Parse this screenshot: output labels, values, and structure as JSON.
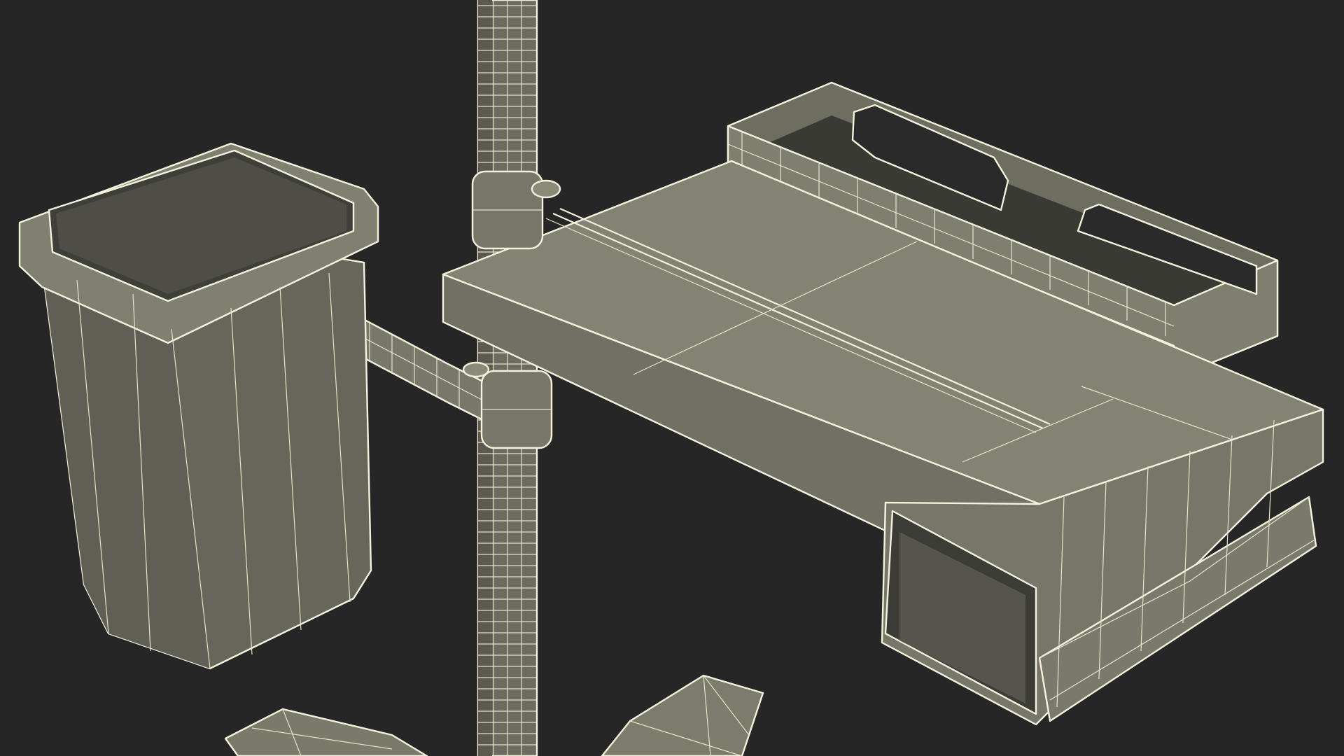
{
  "scene": {
    "colors": {
      "background": "#262626",
      "surface_light": "#80806f",
      "surface_mid": "#6f6f62",
      "surface_dark": "#595950",
      "surface_shadow": "#4a4a43",
      "wire": "#e4e4c9",
      "wire_highlight": "#f3f3dd"
    },
    "objects": [
      "iv-pole",
      "waste-bin",
      "support-arm",
      "tray-table",
      "rear-rail-basket",
      "side-drawer-holder",
      "base-leg-left",
      "base-leg-right"
    ]
  }
}
